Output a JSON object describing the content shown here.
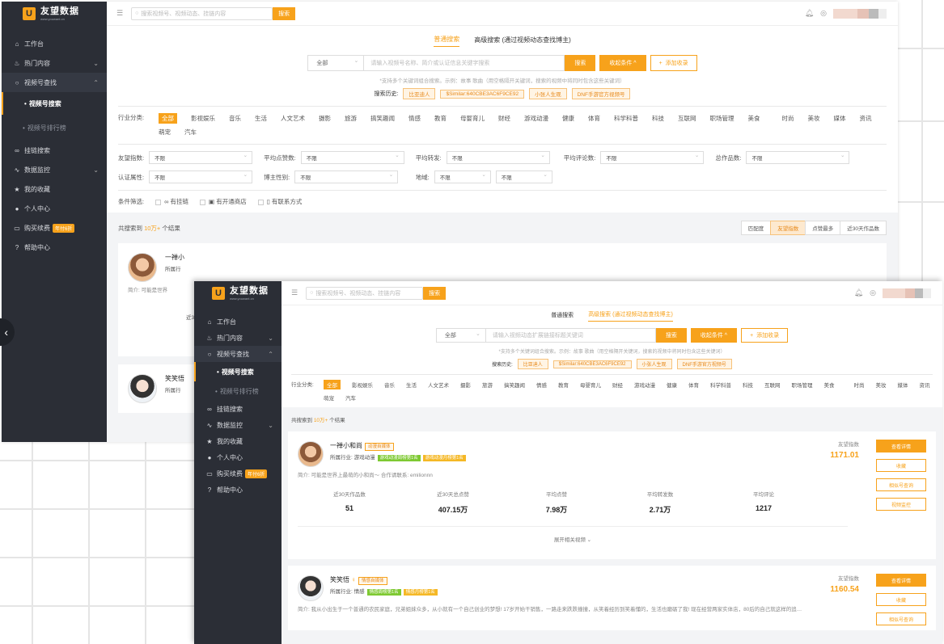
{
  "brand": {
    "name": "友望数据",
    "url": "www.youwant.cn",
    "mark": "U"
  },
  "sidebar": {
    "items": [
      {
        "label": "工作台",
        "icon": "home-icon"
      },
      {
        "label": "热门内容",
        "icon": "fire-icon"
      },
      {
        "label": "视频号查找",
        "icon": "search-icon"
      },
      {
        "label": "视频号搜索",
        "icon": ""
      },
      {
        "label": "视频号排行榜",
        "icon": ""
      },
      {
        "label": "挂链搜索",
        "icon": "link-icon"
      },
      {
        "label": "数据监控",
        "icon": "pulse-icon"
      },
      {
        "label": "我的收藏",
        "icon": "star-icon"
      },
      {
        "label": "个人中心",
        "icon": "user-icon"
      },
      {
        "label": "购买续费",
        "icon": "card-icon"
      },
      {
        "label": "帮助中心",
        "icon": "help-icon"
      }
    ],
    "promo_badge": "年付6折"
  },
  "topbar": {
    "search_placeholder": "搜索视频号、视频动态、挂链内容",
    "search_button": "搜索"
  },
  "search": {
    "tabs": [
      "普通搜索",
      "高级搜索 (通过视频动态查找博主)"
    ],
    "scope": "全部",
    "placeholder_basic": "请输入视频号名称、简介或认证信息关键字搜索",
    "placeholder_adv": "请输入视频动态扩展链接标题关键词",
    "search_button": "搜索",
    "collapse_button": "收起条件 ^",
    "add_button": "添加收录",
    "hint": "*支持多个关键词组合搜索。示例：故事 歌曲（用空格隔开关键词，搜索的视频中将同时包含这些关键词）",
    "history_label": "搜索历史:",
    "history": [
      "比亚迪人",
      "$Similar:640CBE3AC6F9CE92",
      "小张人生观",
      "DNF手游官方视频号"
    ]
  },
  "categories": {
    "label": "行业分类:",
    "items": [
      "全部",
      "影视娱乐",
      "音乐",
      "生活",
      "人文艺术",
      "摄影",
      "旅游",
      "搞笑趣闻",
      "情感",
      "教育",
      "母婴育儿",
      "财经",
      "游戏动漫",
      "健康",
      "体育",
      "科学科普",
      "科技",
      "互联网",
      "职场管理",
      "美食",
      "时尚",
      "美妆",
      "媒体",
      "资讯",
      "萌宠",
      "汽车"
    ]
  },
  "filters": [
    {
      "label": "友望指数:",
      "value": "不限"
    },
    {
      "label": "平均点赞数:",
      "value": "不限"
    },
    {
      "label": "平均转发:",
      "value": "不限"
    },
    {
      "label": "平均评论数:",
      "value": "不限"
    },
    {
      "label": "总作品数:",
      "value": "不限"
    },
    {
      "label": "认证属性:",
      "value": "不限"
    },
    {
      "label": "博主性别:",
      "value": "不限"
    },
    {
      "label": "地域:",
      "value": "不限",
      "value2": "不限"
    }
  ],
  "conditions": {
    "label": "条件筛选:",
    "items": [
      "有挂链",
      "有开通商店",
      "有联系方式"
    ]
  },
  "results": {
    "prefix": "共搜索到",
    "count": "10万+",
    "suffix": "个结果",
    "sorts": [
      "匹配度",
      "友望指数",
      "点赞最多",
      "近30天作品数"
    ]
  },
  "cards": [
    {
      "name": "一禅小和尚",
      "tag": "动漫自媒体",
      "badges": [
        "游戏动漫周榜第1名",
        "游戏动漫月榜第1名"
      ],
      "industry": "所属行业: 游戏动漫",
      "intro": "简介: 可能是世界上最萌的小和尚～ 合作请联系: emilionnn",
      "index_label": "友望指数",
      "index_value": "1171.01",
      "stats": [
        {
          "label": "近30天作品数",
          "value": "51"
        },
        {
          "label": "近30天总点赞",
          "value": "407.15万"
        },
        {
          "label": "平均点赞",
          "value": "7.98万"
        },
        {
          "label": "平均转发数",
          "value": "2.71万"
        },
        {
          "label": "平均评论",
          "value": "1217"
        }
      ],
      "expand": "展开相关视频"
    },
    {
      "name": "笑笑悟",
      "tag": "情感自媒体",
      "badges": [
        "情感周榜第1名",
        "情感月榜第1名"
      ],
      "industry": "所属行业: 情感",
      "intro": "简介: 我从小出生于一个普通的农民家庭，兄弟姐妹众多，从小就有一个自己创业的梦想! 17岁开始干销售，一路走来跌跌撞撞，从笑着经历到笑着懂的，生活也磨砺了我! 现在经营两家实体店，80后的自己就这样的追…",
      "index_label": "友望指数",
      "index_value": "1160.54"
    }
  ],
  "actions": [
    "查看详情",
    "收藏",
    "相似号查询",
    "视频监控"
  ],
  "back_card": {
    "name": "一禅小",
    "industry": "所属行",
    "intro": "简介: 可能是世界",
    "near": "近3",
    "name2": "笑笑悟",
    "industry2": "所属行"
  },
  "colors": {
    "accent": "#f7a21b",
    "sidebar": "#2b2e36"
  }
}
